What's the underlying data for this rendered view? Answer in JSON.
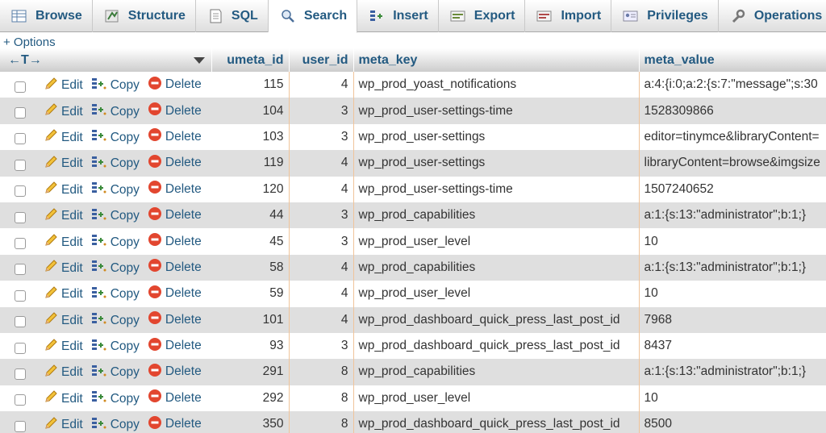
{
  "tabs": [
    {
      "label": "Browse",
      "icon": "browse-icon",
      "active": false
    },
    {
      "label": "Structure",
      "icon": "structure-icon",
      "active": false
    },
    {
      "label": "SQL",
      "icon": "sql-icon",
      "active": false
    },
    {
      "label": "Search",
      "icon": "search-icon",
      "active": true
    },
    {
      "label": "Insert",
      "icon": "insert-icon",
      "active": false
    },
    {
      "label": "Export",
      "icon": "export-icon",
      "active": false
    },
    {
      "label": "Import",
      "icon": "import-icon",
      "active": false
    },
    {
      "label": "Privileges",
      "icon": "privileges-icon",
      "active": false
    },
    {
      "label": "Operations",
      "icon": "wrench-icon",
      "active": false
    }
  ],
  "options_label": "+ Options",
  "header": {
    "arrows": "←T→",
    "columns": [
      "umeta_id",
      "user_id",
      "meta_key",
      "meta_value"
    ]
  },
  "actions": {
    "edit": "Edit",
    "copy": "Copy",
    "delete": "Delete"
  },
  "rows": [
    {
      "umeta_id": "115",
      "user_id": "4",
      "meta_key": "wp_prod_yoast_notifications",
      "meta_value": "a:4:{i:0;a:2:{s:7:\"message\";s:30"
    },
    {
      "umeta_id": "104",
      "user_id": "3",
      "meta_key": "wp_prod_user-settings-time",
      "meta_value": "1528309866"
    },
    {
      "umeta_id": "103",
      "user_id": "3",
      "meta_key": "wp_prod_user-settings",
      "meta_value": "editor=tinymce&libraryContent="
    },
    {
      "umeta_id": "119",
      "user_id": "4",
      "meta_key": "wp_prod_user-settings",
      "meta_value": "libraryContent=browse&imgsize"
    },
    {
      "umeta_id": "120",
      "user_id": "4",
      "meta_key": "wp_prod_user-settings-time",
      "meta_value": "1507240652"
    },
    {
      "umeta_id": "44",
      "user_id": "3",
      "meta_key": "wp_prod_capabilities",
      "meta_value": "a:1:{s:13:\"administrator\";b:1;}"
    },
    {
      "umeta_id": "45",
      "user_id": "3",
      "meta_key": "wp_prod_user_level",
      "meta_value": "10"
    },
    {
      "umeta_id": "58",
      "user_id": "4",
      "meta_key": "wp_prod_capabilities",
      "meta_value": "a:1:{s:13:\"administrator\";b:1;}"
    },
    {
      "umeta_id": "59",
      "user_id": "4",
      "meta_key": "wp_prod_user_level",
      "meta_value": "10"
    },
    {
      "umeta_id": "101",
      "user_id": "4",
      "meta_key": "wp_prod_dashboard_quick_press_last_post_id",
      "meta_value": "7968"
    },
    {
      "umeta_id": "93",
      "user_id": "3",
      "meta_key": "wp_prod_dashboard_quick_press_last_post_id",
      "meta_value": "8437"
    },
    {
      "umeta_id": "291",
      "user_id": "8",
      "meta_key": "wp_prod_capabilities",
      "meta_value": "a:1:{s:13:\"administrator\";b:1;}"
    },
    {
      "umeta_id": "292",
      "user_id": "8",
      "meta_key": "wp_prod_user_level",
      "meta_value": "10"
    },
    {
      "umeta_id": "350",
      "user_id": "8",
      "meta_key": "wp_prod_dashboard_quick_press_last_post_id",
      "meta_value": "8500"
    }
  ],
  "colors": {
    "link": "#235a81",
    "row_alt": "#dfdfdf",
    "delete_red": "#e2462f",
    "col_divider": "#f0c49a"
  }
}
